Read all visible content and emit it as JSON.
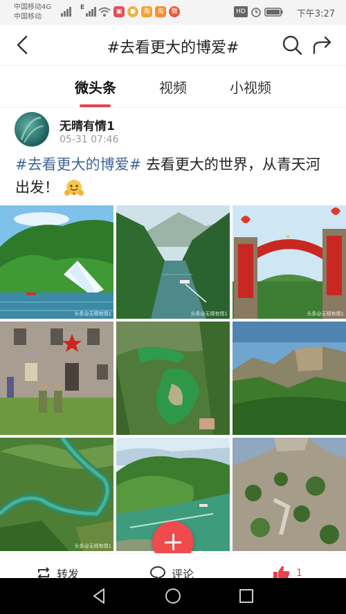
{
  "status_bar": {
    "carrier_1": "中国移动4G",
    "carrier_2": "中国移动",
    "network_1": "4G",
    "network_2": "E",
    "time": "下午3:27",
    "hd_badge": "HD"
  },
  "header": {
    "title": "#去看更大的博爱#",
    "back_icon": "chevron-left",
    "search_icon": "search",
    "share_icon": "share-arrow"
  },
  "tabs": [
    {
      "label": "微头条",
      "active": true
    },
    {
      "label": "视频",
      "active": false
    },
    {
      "label": "小视频",
      "active": false
    }
  ],
  "post": {
    "author": "无晴有情1",
    "date": "05-31 07:46",
    "hashtag": "#去看更大的博爱#",
    "text": " 去看更大的世界，从青天河出发！",
    "emoji": "hugging-face",
    "image_watermark": "头条@无晴有情1",
    "images": [
      {
        "subject": "waterfall-lake"
      },
      {
        "subject": "river-boat-canyon"
      },
      {
        "subject": "red-arch-gate"
      },
      {
        "subject": "stone-building-red-star"
      },
      {
        "subject": "green-lake-valley"
      },
      {
        "subject": "mountain-cliffs"
      },
      {
        "subject": "winding-river-aerial"
      },
      {
        "subject": "green-hill-river"
      },
      {
        "subject": "rocky-peak"
      }
    ]
  },
  "actions": {
    "repost_label": "转发",
    "comment_label": "评论",
    "like_count": "1"
  },
  "colors": {
    "accent": "#e8424f",
    "hashtag": "#406599",
    "fab": "#ef4a4c"
  }
}
